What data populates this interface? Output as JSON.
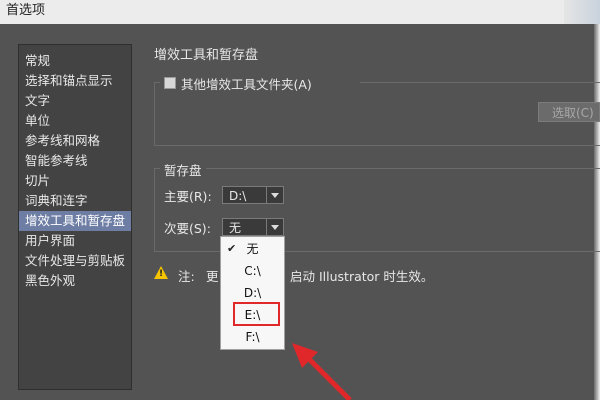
{
  "window": {
    "title": "首选项"
  },
  "sidebar": {
    "items": [
      {
        "label": "常规"
      },
      {
        "label": "选择和锚点显示"
      },
      {
        "label": "文字"
      },
      {
        "label": "单位"
      },
      {
        "label": "参考线和网格"
      },
      {
        "label": "智能参考线"
      },
      {
        "label": "切片"
      },
      {
        "label": "词典和连字"
      },
      {
        "label": "增效工具和暂存盘"
      },
      {
        "label": "用户界面"
      },
      {
        "label": "文件处理与剪贴板"
      },
      {
        "label": "黑色外观"
      }
    ],
    "selected_index": 8
  },
  "plugins": {
    "section_title": "增效工具和暂存盘",
    "other_folder_label": "其他增效工具文件夹(A)",
    "select_button": "选取(C)"
  },
  "scratch": {
    "group_title": "暂存盘",
    "primary_label": "主要(R):",
    "primary_value": "D:\\",
    "secondary_label": "次要(S):",
    "secondary_value": "无"
  },
  "dropdown_menu": {
    "options": [
      "无",
      "C:\\",
      "D:\\",
      "E:\\",
      "F:\\"
    ],
    "checked_index": 0,
    "highlighted_index": 3,
    "check_glyph": "✔"
  },
  "note": {
    "prefix": "注:",
    "text_left": "更",
    "text_right": "启动 Illustrator 时生效。"
  },
  "colors": {
    "highlight_box": "#e0282a",
    "arrow": "#e0282a",
    "selected_item": "#6d7da4",
    "warning": "#f5c400"
  }
}
